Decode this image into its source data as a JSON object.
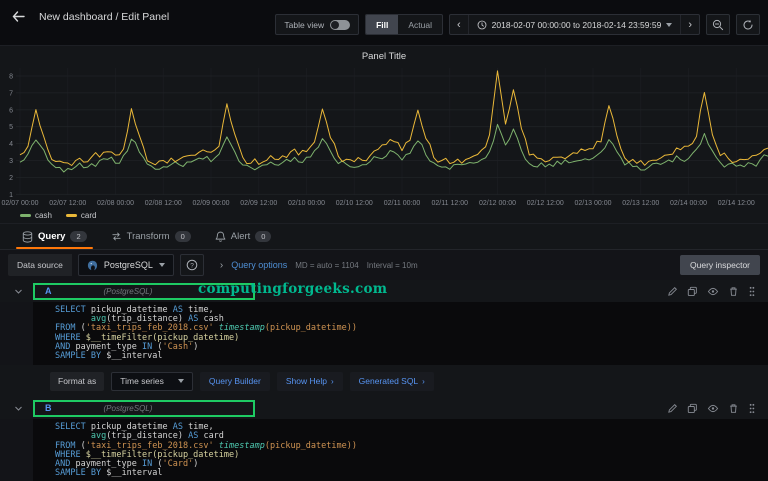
{
  "header": {
    "title": "New dashboard / Edit Panel",
    "table_view_label": "Table view",
    "fill_label": "Fill",
    "actual_label": "Actual",
    "time_range": "2018-02-07 00:00:00 to 2018-02-14 23:59:59"
  },
  "panel": {
    "title": "Panel Title",
    "legend": [
      {
        "label": "cash",
        "color": "#7EB26D"
      },
      {
        "label": "card",
        "color": "#EAB839"
      }
    ]
  },
  "chart_data": {
    "type": "line",
    "title": "Panel Title",
    "x_start": "2018-02-07 00:00",
    "x_end": "2018-02-14 20:00",
    "sample_interval_hours": 2,
    "x_tick_labels": [
      "02/07 00:00",
      "02/07 12:00",
      "02/08 00:00",
      "02/08 12:00",
      "02/09 00:00",
      "02/09 12:00",
      "02/10 00:00",
      "02/10 12:00",
      "02/11 00:00",
      "02/11 12:00",
      "02/12 00:00",
      "02/12 12:00",
      "02/13 00:00",
      "02/13 12:00",
      "02/14 00:00",
      "02/14 12:00"
    ],
    "y_ticks": [
      1,
      2,
      3,
      4,
      5,
      6,
      7,
      8
    ],
    "ylim": [
      0.6,
      8.6
    ],
    "grid": true,
    "legend_position": "bottom-left",
    "series": [
      {
        "name": "cash",
        "color": "#7EB26D",
        "values": [
          3.0,
          3.3,
          4.3,
          3.6,
          2.8,
          2.6,
          2.5,
          2.7,
          2.6,
          2.8,
          2.9,
          3.0,
          2.9,
          3.2,
          4.2,
          3.5,
          2.7,
          2.5,
          2.6,
          2.8,
          2.7,
          2.9,
          3.0,
          3.1,
          3.0,
          3.4,
          4.4,
          3.6,
          2.8,
          2.6,
          2.5,
          2.7,
          2.8,
          2.9,
          3.0,
          2.9,
          3.1,
          3.5,
          4.3,
          3.5,
          2.8,
          2.7,
          2.6,
          2.8,
          2.9,
          3.1,
          3.3,
          3.5,
          3.1,
          3.5,
          4.2,
          3.4,
          2.8,
          2.6,
          2.5,
          2.7,
          2.8,
          2.9,
          3.1,
          3.6,
          5.2,
          4.0,
          4.8,
          3.7,
          2.9,
          2.7,
          2.6,
          2.7,
          2.8,
          2.9,
          3.0,
          3.1,
          3.2,
          3.6,
          4.3,
          3.5,
          2.8,
          2.6,
          2.5,
          2.7,
          2.8,
          2.9,
          3.0,
          3.1,
          3.2,
          3.7,
          4.6,
          3.6,
          2.9,
          2.7,
          2.6,
          2.7,
          2.8,
          3.0,
          3.2
        ]
      },
      {
        "name": "card",
        "color": "#EAB839",
        "values": [
          3.4,
          3.8,
          6.0,
          4.4,
          3.1,
          2.9,
          2.8,
          3.0,
          2.9,
          3.2,
          3.3,
          3.5,
          3.3,
          3.7,
          6.0,
          4.5,
          3.0,
          2.8,
          2.9,
          3.1,
          3.0,
          3.2,
          3.4,
          3.6,
          3.4,
          3.9,
          6.3,
          4.6,
          3.1,
          2.9,
          2.8,
          3.0,
          3.1,
          3.3,
          3.5,
          3.4,
          3.5,
          4.0,
          6.1,
          4.4,
          3.2,
          3.0,
          2.9,
          3.1,
          3.3,
          3.6,
          3.9,
          4.2,
          3.6,
          4.1,
          5.9,
          4.3,
          3.2,
          3.0,
          2.9,
          3.0,
          3.1,
          3.3,
          3.6,
          4.5,
          8.3,
          5.2,
          7.1,
          4.8,
          3.4,
          3.1,
          3.0,
          3.1,
          3.2,
          3.3,
          3.4,
          3.6,
          3.7,
          4.2,
          6.2,
          4.5,
          3.2,
          3.0,
          2.9,
          3.0,
          3.1,
          3.3,
          3.4,
          3.6,
          3.8,
          4.4,
          7.0,
          4.6,
          3.3,
          3.1,
          3.0,
          3.1,
          3.2,
          3.4,
          3.7
        ]
      }
    ]
  },
  "tabs": [
    {
      "label": "Query",
      "count": "2"
    },
    {
      "label": "Transform",
      "count": "0"
    },
    {
      "label": "Alert",
      "count": "0"
    }
  ],
  "datasource_row": {
    "label": "Data source",
    "datasource": "PostgreSQL",
    "query_options_label": "Query options",
    "md_text": "MD = auto = 1104",
    "interval_text": "Interval = 10m",
    "inspector_label": "Query inspector"
  },
  "watermark": "computingforgeeks.com",
  "format_row": {
    "format_as_label": "Format as",
    "format_value": "Time series",
    "query_builder_label": "Query Builder",
    "show_help_label": "Show Help",
    "generated_sql_label": "Generated SQL",
    "chevron": "›"
  },
  "queries": [
    {
      "ref": "A",
      "datasource": "(PostgreSQL)",
      "sql_lines": [
        [
          {
            "c": "k",
            "t": "SELECT"
          },
          {
            "c": "p",
            "t": " pickup_datetime "
          },
          {
            "c": "k",
            "t": "AS"
          },
          {
            "c": "p",
            "t": " time,"
          }
        ],
        [
          {
            "c": "p",
            "t": "       "
          },
          {
            "c": "f",
            "t": "avg"
          },
          {
            "c": "p",
            "t": "(trip_distance) "
          },
          {
            "c": "k",
            "t": "AS"
          },
          {
            "c": "p",
            "t": " cash"
          }
        ],
        [
          {
            "c": "k",
            "t": "FROM"
          },
          {
            "c": "p",
            "t": " ("
          },
          {
            "c": "s",
            "t": "'taxi_trips_feb_2018.csv'"
          },
          {
            "c": "p",
            "t": " "
          },
          {
            "c": "ts",
            "t": "timestamp"
          },
          {
            "c": "s",
            "t": "(pickup_datetime))"
          }
        ],
        [
          {
            "c": "k",
            "t": "WHERE"
          },
          {
            "c": "m",
            "t": " $__timeFilter(pickup_datetime)"
          }
        ],
        [
          {
            "c": "k",
            "t": "AND"
          },
          {
            "c": "p",
            "t": " payment_type "
          },
          {
            "c": "k",
            "t": "IN"
          },
          {
            "c": "p",
            "t": " ("
          },
          {
            "c": "s",
            "t": "'Cash'"
          },
          {
            "c": "p",
            "t": ")"
          }
        ],
        [
          {
            "c": "k",
            "t": "SAMPLE"
          },
          {
            "c": "p",
            "t": " "
          },
          {
            "c": "k",
            "t": "BY"
          },
          {
            "c": "p",
            "t": " $__interval"
          }
        ]
      ]
    },
    {
      "ref": "B",
      "datasource": "(PostgreSQL)",
      "sql_lines": [
        [
          {
            "c": "k",
            "t": "SELECT"
          },
          {
            "c": "p",
            "t": " pickup_datetime "
          },
          {
            "c": "k",
            "t": "AS"
          },
          {
            "c": "p",
            "t": " time,"
          }
        ],
        [
          {
            "c": "p",
            "t": "       "
          },
          {
            "c": "f",
            "t": "avg"
          },
          {
            "c": "p",
            "t": "(trip_distance) "
          },
          {
            "c": "k",
            "t": "AS"
          },
          {
            "c": "p",
            "t": " card"
          }
        ],
        [
          {
            "c": "k",
            "t": "FROM"
          },
          {
            "c": "p",
            "t": " ("
          },
          {
            "c": "s",
            "t": "'taxi_trips_feb_2018.csv'"
          },
          {
            "c": "p",
            "t": " "
          },
          {
            "c": "ts",
            "t": "timestamp"
          },
          {
            "c": "s",
            "t": "(pickup_datetime))"
          }
        ],
        [
          {
            "c": "k",
            "t": "WHERE"
          },
          {
            "c": "m",
            "t": " $__timeFilter(pickup_datetime)"
          }
        ],
        [
          {
            "c": "k",
            "t": "AND"
          },
          {
            "c": "p",
            "t": " payment_type "
          },
          {
            "c": "k",
            "t": "IN"
          },
          {
            "c": "p",
            "t": " ("
          },
          {
            "c": "s",
            "t": "'Card'"
          },
          {
            "c": "p",
            "t": ")"
          }
        ],
        [
          {
            "c": "k",
            "t": "SAMPLE"
          },
          {
            "c": "p",
            "t": " "
          },
          {
            "c": "k",
            "t": "BY"
          },
          {
            "c": "p",
            "t": " $__interval"
          }
        ]
      ]
    }
  ]
}
